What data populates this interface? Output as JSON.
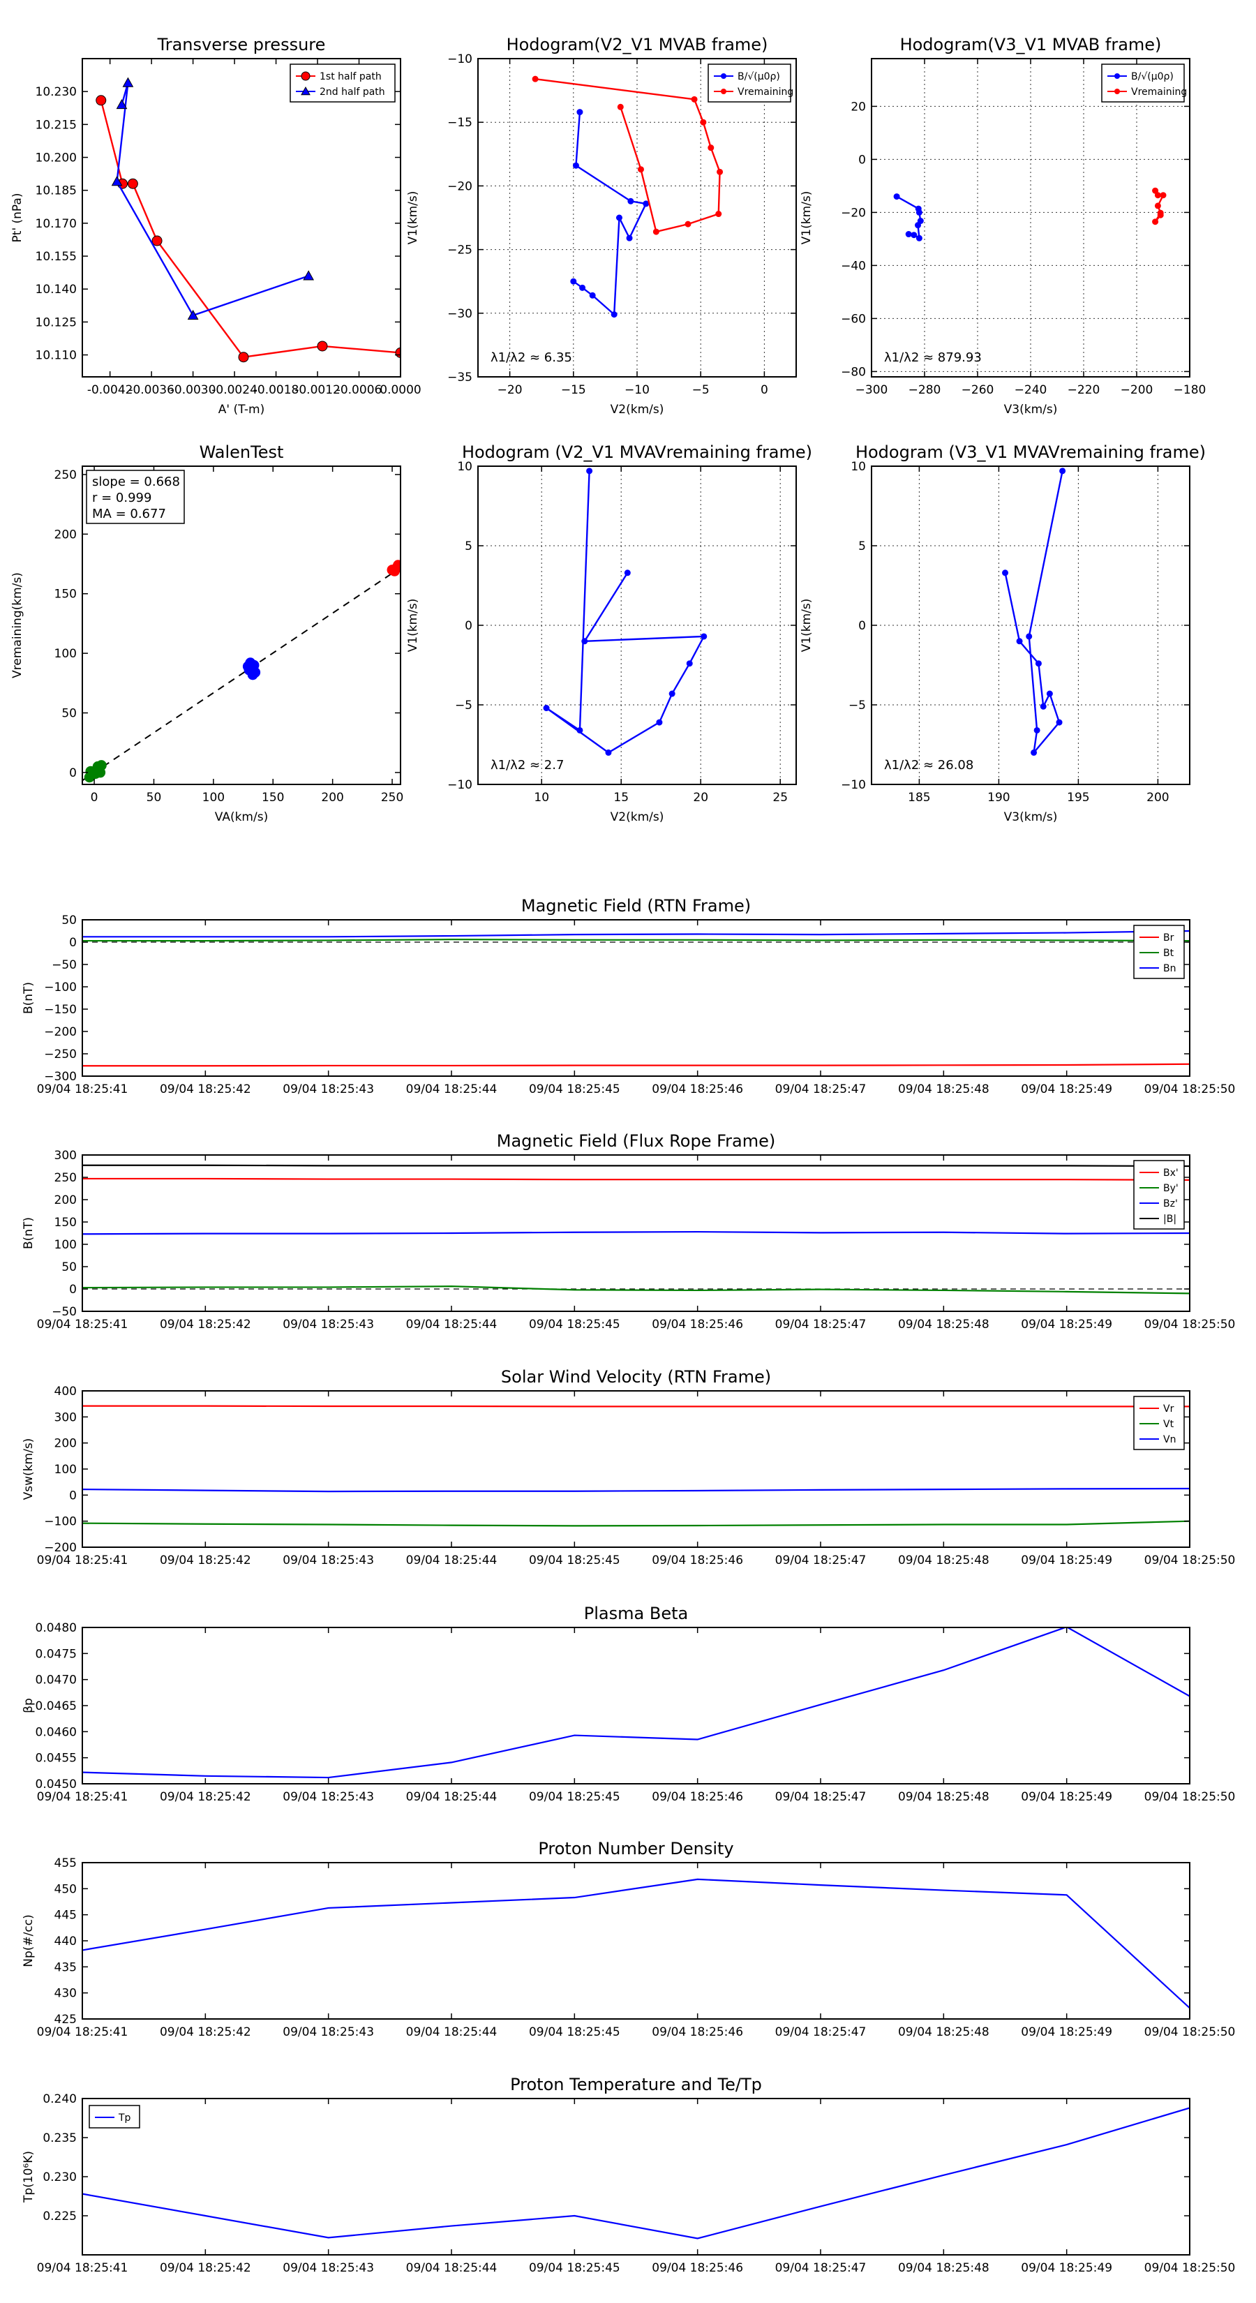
{
  "figure": {
    "time_ticks": [
      "09/04 18:25:41",
      "09/04 18:25:42",
      "09/04 18:25:43",
      "09/04 18:25:44",
      "09/04 18:25:45",
      "09/04 18:25:46",
      "09/04 18:25:47",
      "09/04 18:25:48",
      "09/04 18:25:49",
      "09/04 18:25:50"
    ]
  },
  "chart_data": [
    {
      "id": "pt",
      "type": "line",
      "title": "Transverse pressure",
      "xlabel": "A' (T-m)",
      "ylabel": "Pt' (nPa)",
      "xlim": [
        -0.0046,
        0.0
      ],
      "ylim": [
        10.1,
        10.245
      ],
      "xticks": [
        -0.0042,
        -0.0036,
        -0.003,
        -0.0024,
        -0.0018,
        -0.0012,
        -0.0006,
        0.0
      ],
      "xticklabels": [
        "-0.0042",
        "-0.0036",
        "-0.0030",
        "-0.0024",
        "-0.0018",
        "-0.0012",
        "-0.0006",
        "0.0000"
      ],
      "yticks": [
        10.11,
        10.125,
        10.14,
        10.155,
        10.17,
        10.185,
        10.2,
        10.215,
        10.23
      ],
      "yticklabels": [
        "10.110",
        "10.125",
        "10.140",
        "10.155",
        "10.170",
        "10.185",
        "10.200",
        "10.215",
        "10.230"
      ],
      "grid": false,
      "legend_position": "top-right",
      "series": [
        {
          "name": "1st half path",
          "color": "#ff0000",
          "marker": "circle",
          "x": [
            -0.00433,
            -0.00402,
            -0.00387,
            -0.00352,
            -0.00227,
            -0.00113,
            0.0
          ],
          "y": [
            10.226,
            10.188,
            10.188,
            10.162,
            10.109,
            10.114,
            10.111
          ]
        },
        {
          "name": "2nd half path",
          "color": "#0000ff",
          "marker": "triangle",
          "x": [
            -0.00403,
            -0.00394,
            -0.0041,
            -0.003,
            -0.00133
          ],
          "y": [
            10.224,
            10.234,
            10.189,
            10.128,
            10.146
          ]
        }
      ]
    },
    {
      "id": "h1",
      "type": "line",
      "title": "Hodogram(V2_V1 MVAB frame)",
      "xlabel": "V2(km/s)",
      "ylabel": "V1(km/s)",
      "xlim": [
        -22.5,
        2.5
      ],
      "ylim": [
        -35,
        -10
      ],
      "xticks": [
        -20,
        -15,
        -10,
        -5,
        0
      ],
      "xticklabels": [
        "−20",
        "−15",
        "−10",
        "−5",
        "0"
      ],
      "yticks": [
        -35,
        -30,
        -25,
        -20,
        -15,
        -10
      ],
      "yticklabels": [
        "−35",
        "−30",
        "−25",
        "−20",
        "−15",
        "−10"
      ],
      "grid": true,
      "legend_position": "top-right",
      "annotation": "λ1/λ2 ≈ 6.35",
      "series": [
        {
          "name": "B/√(μ0ρ)",
          "color": "#0000ff",
          "x": [
            -14.5,
            -14.8,
            -10.5,
            -9.3,
            -10.6,
            -11.4,
            -11.8,
            -13.5,
            -14.3,
            -15
          ],
          "y": [
            -14.2,
            -18.4,
            -21.2,
            -21.4,
            -24.1,
            -22.5,
            -30.1,
            -28.6,
            -28.0,
            -27.5
          ]
        },
        {
          "name": "Vremaining",
          "color": "#ff0000",
          "x": [
            -18,
            -5.5,
            -4.8,
            -4.2,
            -3.5,
            -3.6,
            -6,
            -8.5,
            -9.7,
            -11.3
          ],
          "y": [
            -11.6,
            -13.2,
            -15,
            -17,
            -18.9,
            -22.2,
            -23,
            -23.6,
            -18.7,
            -13.8
          ]
        }
      ]
    },
    {
      "id": "h2",
      "type": "line",
      "title": "Hodogram(V3_V1 MVAB frame)",
      "xlabel": "V3(km/s)",
      "ylabel": "V1(km/s)",
      "xlim": [
        -300,
        -180
      ],
      "ylim": [
        -82,
        38
      ],
      "xticks": [
        -300,
        -280,
        -260,
        -240,
        -220,
        -200,
        -180
      ],
      "xticklabels": [
        "−300",
        "−280",
        "−260",
        "−240",
        "−220",
        "−200",
        "−180"
      ],
      "yticks": [
        -80,
        -60,
        -40,
        -20,
        0,
        20
      ],
      "yticklabels": [
        "−80",
        "−60",
        "−40",
        "−20",
        "0",
        "20"
      ],
      "grid": true,
      "legend_position": "top-right",
      "annotation": "λ1/λ2 ≈ 879.93",
      "series": [
        {
          "name": "B/√(μ0ρ)",
          "color": "#0000ff",
          "x": [
            -290.5,
            -282.3,
            -282,
            -281.5,
            -282.5,
            -282,
            -284,
            -286
          ],
          "y": [
            -14,
            -18.6,
            -20,
            -23.2,
            -24.8,
            -29.7,
            -28.5,
            -28.2
          ]
        },
        {
          "name": "Vremaining",
          "color": "#ff0000",
          "x": [
            -193,
            -192,
            -190,
            -192,
            -191,
            -193,
            -191
          ],
          "y": [
            -11.8,
            -13.5,
            -13.5,
            -17.5,
            -20.2,
            -23.5,
            -21
          ]
        }
      ]
    },
    {
      "id": "walen",
      "type": "scatter",
      "title": "WalenTest",
      "xlabel": "VA(km/s)",
      "ylabel": "Vremaining(km/s)",
      "xlim": [
        -10,
        257
      ],
      "ylim": [
        -10,
        257
      ],
      "xticks": [
        0,
        50,
        100,
        150,
        200,
        250
      ],
      "xticklabels": [
        "0",
        "50",
        "100",
        "150",
        "200",
        "250"
      ],
      "yticks": [
        0,
        50,
        100,
        150,
        200,
        250
      ],
      "yticklabels": [
        "0",
        "50",
        "100",
        "150",
        "200",
        "250"
      ],
      "grid": false,
      "annotation": [
        "slope = 0.668",
        "r = 0.999",
        "MA = 0.677"
      ],
      "fit_line": {
        "x": [
          -10,
          257
        ],
        "y": [
          -6.7,
          171.8
        ]
      },
      "series": [
        {
          "name": "",
          "color": "#008000",
          "x": [
            -4,
            -2,
            0,
            2,
            4,
            6,
            3,
            1,
            -3,
            5
          ],
          "y": [
            -4,
            -2,
            0,
            2,
            4,
            6,
            5,
            -1,
            1,
            0
          ]
        },
        {
          "name": "",
          "color": "#0000ff",
          "x": [
            130,
            132,
            134,
            131,
            135,
            133,
            129
          ],
          "y": [
            86,
            88,
            90,
            92,
            84,
            82,
            89
          ]
        },
        {
          "name": "",
          "color": "#ff0000",
          "x": [
            250,
            253,
            255,
            252
          ],
          "y": [
            170,
            171,
            174,
            169
          ]
        }
      ]
    },
    {
      "id": "h3",
      "type": "line",
      "title": "Hodogram (V2_V1 MVAVremaining frame)",
      "xlabel": "V2(km/s)",
      "ylabel": "V1(km/s)",
      "xlim": [
        6,
        26
      ],
      "ylim": [
        -10,
        10
      ],
      "xticks": [
        10,
        15,
        20,
        25
      ],
      "xticklabels": [
        "10",
        "15",
        "20",
        "25"
      ],
      "yticks": [
        -10,
        -5,
        0,
        5,
        10
      ],
      "yticklabels": [
        "−10",
        "−5",
        "0",
        "5",
        "10"
      ],
      "grid": true,
      "annotation": "λ1/λ2 ≈ 2.7",
      "series": [
        {
          "name": "",
          "color": "#0000ff",
          "x": [
            15.4,
            12.7,
            20.2,
            19.3,
            18.2,
            17.4,
            14.2,
            10.3,
            12.4,
            13.0
          ],
          "y": [
            3.3,
            -1.0,
            -0.7,
            -2.4,
            -4.3,
            -6.1,
            -8.0,
            -5.2,
            -6.6,
            9.7
          ]
        }
      ]
    },
    {
      "id": "h4",
      "type": "line",
      "title": "Hodogram (V3_V1 MVAVremaining frame)",
      "xlabel": "V3(km/s)",
      "ylabel": "V1(km/s)",
      "xlim": [
        182,
        202
      ],
      "ylim": [
        -10,
        10
      ],
      "xticks": [
        185,
        190,
        195,
        200
      ],
      "xticklabels": [
        "185",
        "190",
        "195",
        "200"
      ],
      "yticks": [
        -10,
        -5,
        0,
        5,
        10
      ],
      "yticklabels": [
        "−10",
        "−5",
        "0",
        "5",
        "10"
      ],
      "grid": true,
      "annotation": "λ1/λ2 ≈ 26.08",
      "series": [
        {
          "name": "",
          "color": "#0000ff",
          "x": [
            190.4,
            191.3,
            192.5,
            192.8,
            193.2,
            193.8,
            192.2,
            192.4,
            191.9,
            194.0
          ],
          "y": [
            3.3,
            -1.0,
            -2.4,
            -5.1,
            -4.3,
            -6.1,
            -8.0,
            -6.6,
            -0.7,
            9.7
          ]
        }
      ]
    },
    {
      "id": "b_rtn",
      "type": "line",
      "title": "Magnetic Field (RTN Frame)",
      "ylabel": "B(nT)",
      "xlim": [
        0,
        9
      ],
      "ylim": [
        -300,
        50
      ],
      "yticks": [
        -300,
        -250,
        -200,
        -150,
        -100,
        -50,
        0,
        50
      ],
      "yticklabels": [
        "−300",
        "−250",
        "−200",
        "−150",
        "−100",
        "−50",
        "0",
        "50"
      ],
      "zero_line": true,
      "legend_position": "top-right",
      "series": [
        {
          "name": "Br",
          "color": "#ff0000",
          "x": [
            0,
            1,
            2,
            3,
            4,
            5,
            6,
            7,
            8,
            9
          ],
          "y": [
            -277,
            -277,
            -276.5,
            -276.5,
            -276,
            -276,
            -276,
            -275.5,
            -275,
            -273
          ]
        },
        {
          "name": "Bt",
          "color": "#008000",
          "x": [
            0,
            1,
            2,
            3,
            4,
            5,
            6,
            7,
            8,
            9
          ],
          "y": [
            3,
            3,
            4,
            6,
            5,
            5,
            4,
            5,
            4,
            3
          ]
        },
        {
          "name": "Bn",
          "color": "#0000ff",
          "x": [
            0,
            1,
            2,
            3,
            4,
            5,
            6,
            7,
            8,
            9
          ],
          "y": [
            12,
            12,
            12,
            14,
            17,
            18,
            17,
            19,
            21,
            25
          ]
        }
      ]
    },
    {
      "id": "b_fr",
      "type": "line",
      "title": "Magnetic Field (Flux Rope Frame)",
      "ylabel": "B(nT)",
      "xlim": [
        0,
        9
      ],
      "ylim": [
        -50,
        300
      ],
      "yticks": [
        -50,
        0,
        50,
        100,
        150,
        200,
        250,
        300
      ],
      "yticklabels": [
        "−50",
        "0",
        "50",
        "100",
        "150",
        "200",
        "250",
        "300"
      ],
      "zero_line": true,
      "legend_position": "top-right",
      "series": [
        {
          "name": "Bx'",
          "color": "#ff0000",
          "x": [
            0,
            1,
            2,
            3,
            4,
            5,
            6,
            7,
            8,
            9
          ],
          "y": [
            247,
            247,
            246,
            246,
            245,
            245,
            245,
            245,
            245,
            244
          ]
        },
        {
          "name": "By'",
          "color": "#008000",
          "x": [
            0,
            1,
            2,
            3,
            4,
            5,
            6,
            7,
            8,
            9
          ],
          "y": [
            3,
            4,
            4,
            6,
            -2,
            -3,
            -1,
            -3,
            -6,
            -10
          ]
        },
        {
          "name": "Bz'",
          "color": "#0000ff",
          "x": [
            0,
            1,
            2,
            3,
            4,
            5,
            6,
            7,
            8,
            9
          ],
          "y": [
            123,
            124,
            124,
            125,
            127,
            128,
            126,
            127,
            124,
            125
          ]
        },
        {
          "name": "|B|",
          "color": "#000000",
          "x": [
            0,
            1,
            2,
            3,
            4,
            5,
            6,
            7,
            8,
            9
          ],
          "y": [
            277,
            277,
            276,
            276,
            276,
            276,
            276,
            276,
            276,
            275
          ]
        }
      ]
    },
    {
      "id": "v_rtn",
      "type": "line",
      "title": "Solar Wind Velocity (RTN Frame)",
      "ylabel": "Vsw(km/s)",
      "xlim": [
        0,
        9
      ],
      "ylim": [
        -200,
        400
      ],
      "yticks": [
        -200,
        -100,
        0,
        100,
        200,
        300,
        400
      ],
      "yticklabels": [
        "−200",
        "−100",
        "0",
        "100",
        "200",
        "300",
        "400"
      ],
      "legend_position": "top-right",
      "series": [
        {
          "name": "Vr",
          "color": "#ff0000",
          "x": [
            0,
            1,
            2,
            3,
            4,
            5,
            6,
            7,
            8,
            9
          ],
          "y": [
            342,
            342,
            341,
            341,
            340,
            340,
            340,
            340,
            340,
            340
          ]
        },
        {
          "name": "Vt",
          "color": "#008000",
          "x": [
            0,
            1,
            2,
            3,
            4,
            5,
            6,
            7,
            8,
            9
          ],
          "y": [
            -108,
            -111,
            -113,
            -116,
            -118,
            -117,
            -115,
            -113,
            -113,
            -100
          ]
        },
        {
          "name": "Vn",
          "color": "#0000ff",
          "x": [
            0,
            1,
            2,
            3,
            4,
            5,
            6,
            7,
            8,
            9
          ],
          "y": [
            22,
            18,
            14,
            15,
            15,
            17,
            20,
            22,
            24,
            25
          ]
        }
      ]
    },
    {
      "id": "beta",
      "type": "line",
      "title": "Plasma Beta",
      "ylabel": "βp",
      "xlim": [
        0,
        9
      ],
      "ylim": [
        0.045,
        0.048
      ],
      "yticks": [
        0.045,
        0.0455,
        0.046,
        0.0465,
        0.047,
        0.0475,
        0.048
      ],
      "yticklabels": [
        "0.0450",
        "0.0455",
        "0.0460",
        "0.0465",
        "0.0470",
        "0.0475",
        "0.0480"
      ],
      "series": [
        {
          "name": "",
          "color": "#0000ff",
          "x": [
            0,
            1,
            2,
            3,
            4,
            5,
            6,
            7,
            8,
            9
          ],
          "y": [
            0.04522,
            0.04515,
            0.04512,
            0.04541,
            0.04593,
            0.04585,
            0.04652,
            0.04718,
            0.04801,
            0.04668
          ]
        }
      ]
    },
    {
      "id": "np",
      "type": "line",
      "title": "Proton Number Density",
      "ylabel": "Np(#/cc)",
      "xlim": [
        0,
        9
      ],
      "ylim": [
        425,
        455
      ],
      "yticks": [
        425,
        430,
        435,
        440,
        445,
        450,
        455
      ],
      "yticklabels": [
        "425",
        "430",
        "435",
        "440",
        "445",
        "450",
        "455"
      ],
      "series": [
        {
          "name": "",
          "color": "#0000ff",
          "x": [
            0,
            1,
            2,
            3,
            4,
            5,
            6,
            7,
            8,
            9
          ],
          "y": [
            438.2,
            442.2,
            446.3,
            447.3,
            448.3,
            451.8,
            450.7,
            449.7,
            448.8,
            427.1
          ]
        }
      ]
    },
    {
      "id": "tp",
      "type": "line",
      "title": "Proton Temperature and Te/Tp",
      "ylabel": "Tp(10⁶K)",
      "xlim": [
        0,
        9
      ],
      "ylim": [
        0.22,
        0.24
      ],
      "yticks": [
        0.225,
        0.23,
        0.235,
        0.24
      ],
      "yticklabels": [
        "0.225",
        "0.230",
        "0.235",
        "0.240"
      ],
      "legend_position": "top-left",
      "series": [
        {
          "name": "Tp",
          "color": "#0000ff",
          "x": [
            0,
            1,
            2,
            3,
            4,
            5,
            6,
            7,
            8,
            9
          ],
          "y": [
            0.2278,
            0.225,
            0.2222,
            0.2237,
            0.225,
            0.2221,
            0.2262,
            0.2302,
            0.2341,
            0.2388
          ]
        }
      ]
    }
  ]
}
